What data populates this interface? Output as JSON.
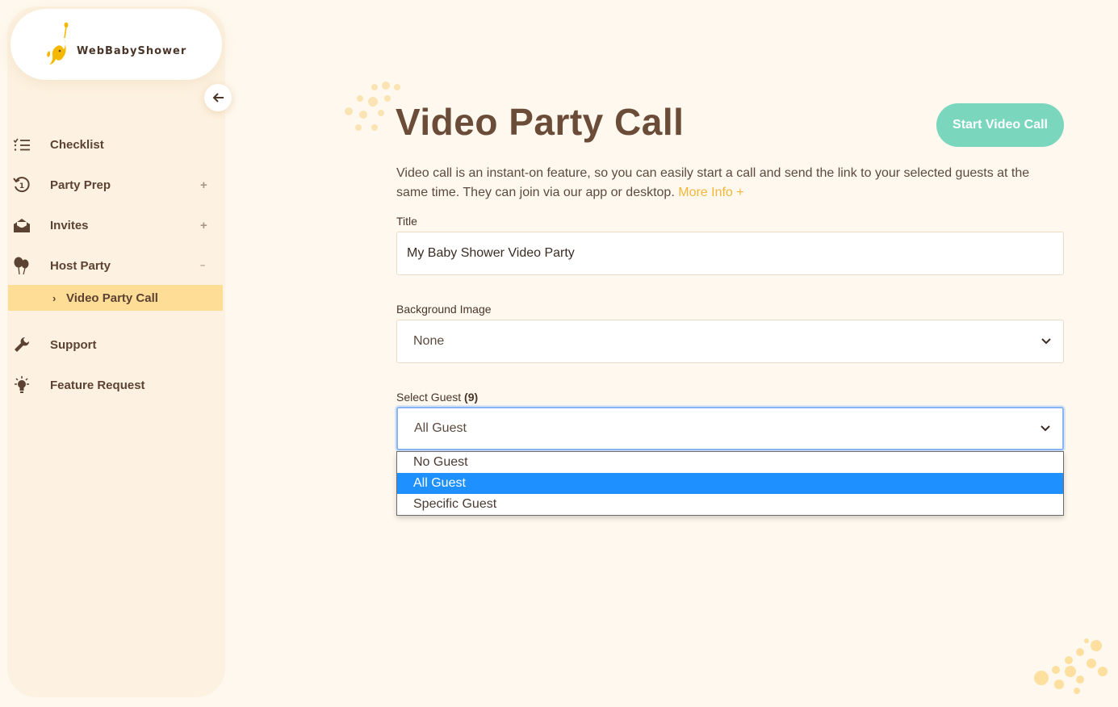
{
  "sidebar": {
    "logo_text": "WebBabyShower",
    "collapse_icon": "arrow-left-icon",
    "items": [
      {
        "label": "Checklist",
        "icon": "list-icon",
        "toggle": ""
      },
      {
        "label": "Party Prep",
        "icon": "history-icon",
        "toggle": "+"
      },
      {
        "label": "Invites",
        "icon": "open-envelope-icon",
        "toggle": "+"
      },
      {
        "label": "Host Party",
        "icon": "balloons-icon",
        "toggle": "–"
      },
      {
        "label": "Support",
        "icon": "wrench-icon",
        "toggle": ""
      },
      {
        "label": "Feature Request",
        "icon": "lightbulb-icon",
        "toggle": ""
      }
    ],
    "active_sub_item": {
      "chevron": "›",
      "label": "Video Party Call"
    }
  },
  "main": {
    "title": "Video Party Call",
    "start_button": "Start Video Call",
    "description": "Video call is an instant-on feature, so you can easily start a call and send the link to your selected guests at the same time. They can join via our app or desktop.",
    "more_info": "More Info +",
    "title_field": {
      "label": "Title",
      "value": "My Baby Shower Video Party"
    },
    "background_field": {
      "label": "Background Image",
      "value": "None"
    },
    "guest_field": {
      "label": "Select Guest",
      "count": "(9)",
      "value": "All Guest"
    },
    "guest_options": [
      "No Guest",
      "All Guest",
      "Specific Guest"
    ],
    "selected_option_index": 1
  },
  "colors": {
    "page_bg": "#fef8ee",
    "sidebar_bg": "#fdf2e1",
    "active_item_bg": "#fedd96",
    "accent_button": "#7bd6be",
    "link": "#f2b73a",
    "title_brown": "#6b4c38",
    "dropdown_selected": "#1e90ff"
  }
}
